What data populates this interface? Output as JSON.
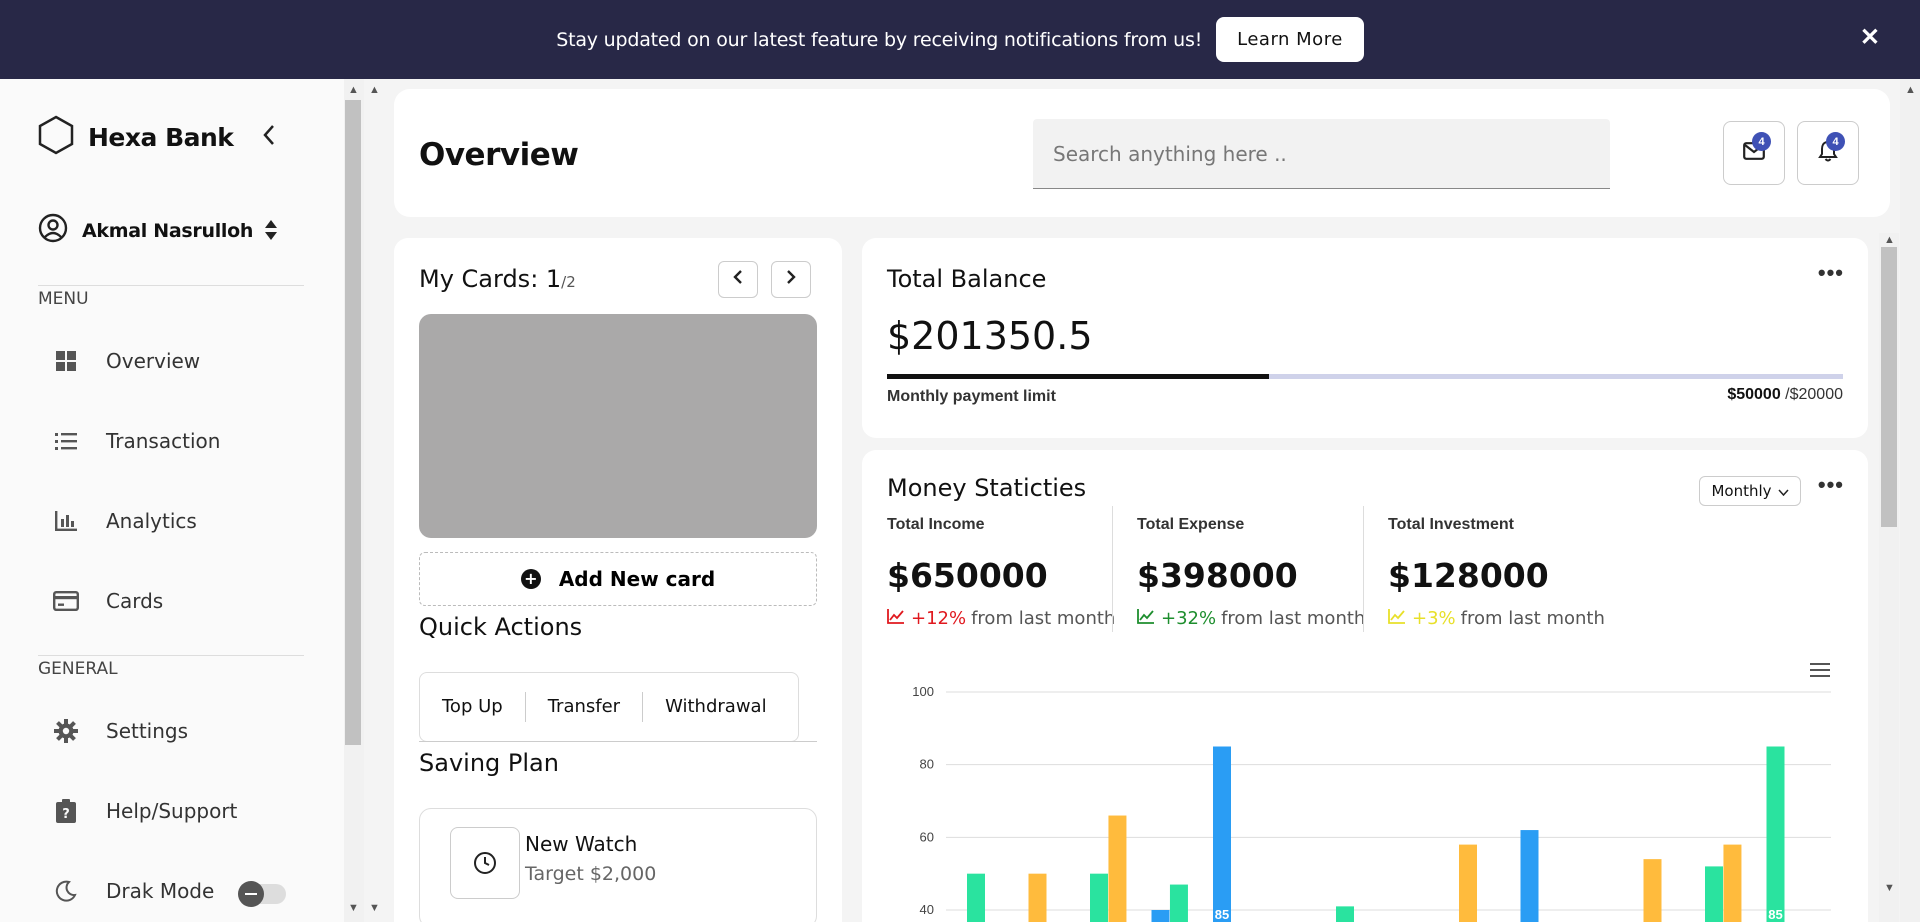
{
  "banner": {
    "text": "Stay updated on our latest feature by receiving notifications from us!",
    "button_label": "Learn More",
    "close_label": "✕"
  },
  "sidebar": {
    "brand": "Hexa Bank",
    "user_name": "Akmal Nasrulloh",
    "menu_label": "MENU",
    "general_label": "GENERAL",
    "items": [
      {
        "label": "Overview",
        "icon": "grid-icon"
      },
      {
        "label": "Transaction",
        "icon": "list-icon"
      },
      {
        "label": "Analytics",
        "icon": "bar-chart-icon"
      },
      {
        "label": "Cards",
        "icon": "credit-card-icon"
      },
      {
        "label": "Settings",
        "icon": "gear-icon"
      },
      {
        "label": "Help/Support",
        "icon": "clipboard-help-icon"
      },
      {
        "label": "Drak Mode",
        "icon": "moon-icon"
      }
    ],
    "dark_mode_on": false
  },
  "header": {
    "title": "Overview",
    "search_placeholder": "Search anything here ..",
    "mail_badge": "4",
    "bell_badge": "4"
  },
  "cards": {
    "title": "My Cards: 1",
    "page_total": "/2",
    "add_label": "Add New card",
    "quick_actions_title": "Quick Actions",
    "quick_actions": [
      "Top Up",
      "Transfer",
      "Withdrawal"
    ],
    "saving_title": "Saving Plan",
    "plan_name": "New Watch",
    "plan_target": "Target $2,000"
  },
  "balance": {
    "title": "Total Balance",
    "amount": "$201350.5",
    "limit_label": "Monthly payment limit",
    "limit_used": "$50000",
    "limit_max": " /$20000",
    "limit_fill_fraction": 0.4
  },
  "stats": {
    "title": "Money Staticties",
    "period": "Monthly",
    "items": [
      {
        "label": "Total Income",
        "value": "$650000",
        "pct": "+12%",
        "rest": "from last month",
        "color": "#e0191f"
      },
      {
        "label": "Total Expense",
        "value": "$398000",
        "pct": "+32%",
        "rest": "from last month",
        "color": "#1e8e2e"
      },
      {
        "label": "Total Investment",
        "value": "$128000",
        "pct": "+3%",
        "rest": "from last month",
        "color": "#e8e02a"
      }
    ]
  },
  "chart_data": {
    "type": "bar",
    "ylim": [
      40,
      100
    ],
    "yticks": [
      100,
      80,
      60,
      40
    ],
    "colors": {
      "green": "#2ae39f",
      "orange": "#ffbb3d",
      "blue": "#2a9df4"
    },
    "bars": [
      {
        "x": 1,
        "series": "green",
        "value": 50
      },
      {
        "x": 2,
        "series": "orange",
        "value": 50
      },
      {
        "x": 3,
        "series": "green",
        "value": 50
      },
      {
        "x": 3.3,
        "series": "orange",
        "value": 66
      },
      {
        "x": 4,
        "series": "blue",
        "value": 40
      },
      {
        "x": 4.3,
        "series": "green",
        "value": 47
      },
      {
        "x": 5,
        "series": "blue",
        "value": 85,
        "label": "85"
      },
      {
        "x": 7,
        "series": "green",
        "value": 41
      },
      {
        "x": 9,
        "series": "orange",
        "value": 58
      },
      {
        "x": 10,
        "series": "blue",
        "value": 62
      },
      {
        "x": 12,
        "series": "orange",
        "value": 54
      },
      {
        "x": 13,
        "series": "green",
        "value": 52
      },
      {
        "x": 13.3,
        "series": "orange",
        "value": 58
      },
      {
        "x": 14,
        "series": "green",
        "value": 85,
        "label": "85"
      }
    ]
  }
}
